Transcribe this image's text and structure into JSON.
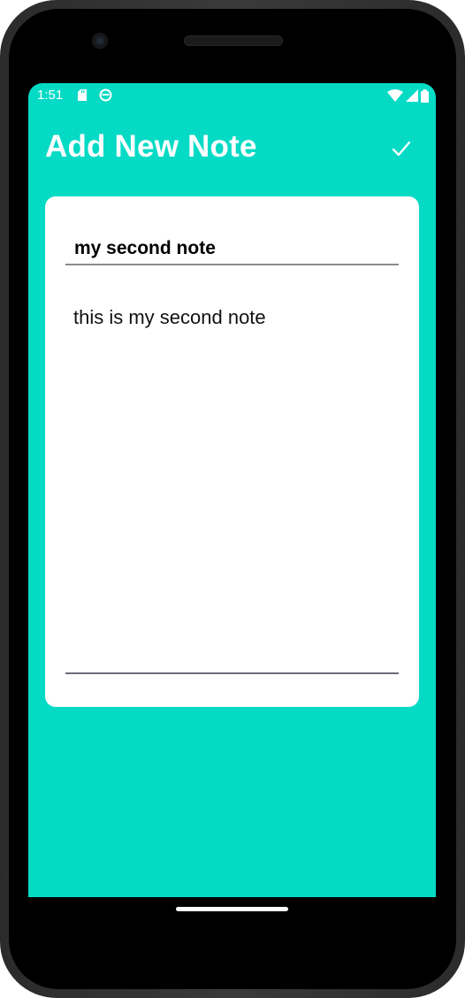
{
  "status_bar": {
    "time": "1:51",
    "icons": [
      "sd-card-icon",
      "app-notification-icon",
      "wifi-icon",
      "signal-icon",
      "battery-icon"
    ]
  },
  "app_bar": {
    "title": "Add New Note",
    "save_icon": "checkmark-icon"
  },
  "note_form": {
    "title_value": "my second note",
    "body_value": "this is my second note"
  },
  "colors": {
    "accent": "#05dac5",
    "card": "#ffffff",
    "frame": "#000000"
  }
}
